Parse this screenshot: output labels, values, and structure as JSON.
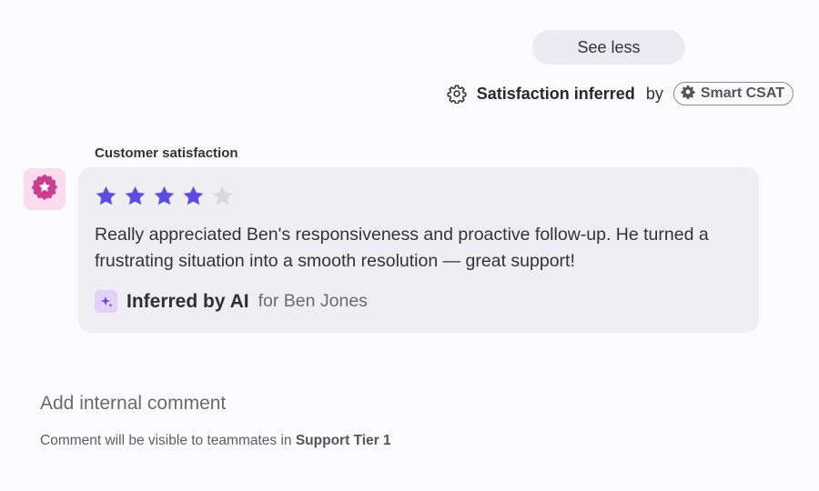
{
  "header": {
    "see_less_label": "See less",
    "satisfaction_title": "Satisfaction inferred",
    "by_text": "by",
    "badge_label": "Smart CSAT"
  },
  "feedback": {
    "section_label": "Customer satisfaction",
    "rating": 4,
    "max_rating": 5,
    "comment": "Really appreciated Ben's responsiveness and proactive follow-up. He turned a frustrating situation into a smooth resolution — great support!",
    "ai_label": "Inferred by AI",
    "ai_for": "for Ben Jones"
  },
  "comment_box": {
    "placeholder": "Add internal comment",
    "visibility_prefix": "Comment will be visible to teammates in",
    "team_name": "Support Tier 1"
  },
  "colors": {
    "star_filled": "#5b4ee8",
    "star_empty": "#d9d8dd",
    "avatar_bg": "#fbdcef",
    "avatar_badge": "#cc3d8e",
    "ai_icon_bg": "#e3d2f6",
    "ai_icon": "#7b3fcf"
  },
  "icons": {
    "header": "gear-icon",
    "badge": "gear-solid-icon",
    "avatar": "star-badge-icon",
    "ai": "sparkle-icon"
  }
}
